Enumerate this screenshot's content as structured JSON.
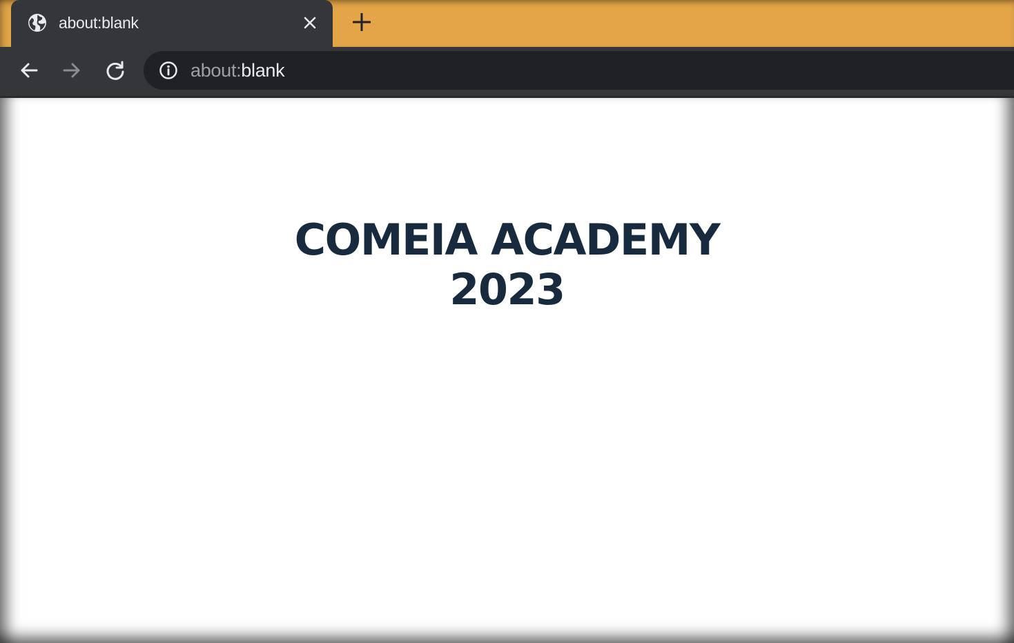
{
  "browser": {
    "tab": {
      "title": "about:blank",
      "icon": "globe-icon"
    },
    "new_tab_icon": "plus-icon",
    "nav": {
      "back_icon": "arrow-left-icon",
      "forward_icon": "arrow-right-icon",
      "reload_icon": "reload-icon"
    },
    "omnibox": {
      "info_icon": "info-icon",
      "url_scheme": "about:",
      "url_rest": "blank"
    },
    "colors": {
      "tabstrip": "#e3a548",
      "toolbar": "#35363a",
      "omnibox": "#202124"
    }
  },
  "page": {
    "headline_line1": "COMEIA ACADEMY",
    "headline_line2": "2023",
    "text_color": "#172a3e"
  }
}
